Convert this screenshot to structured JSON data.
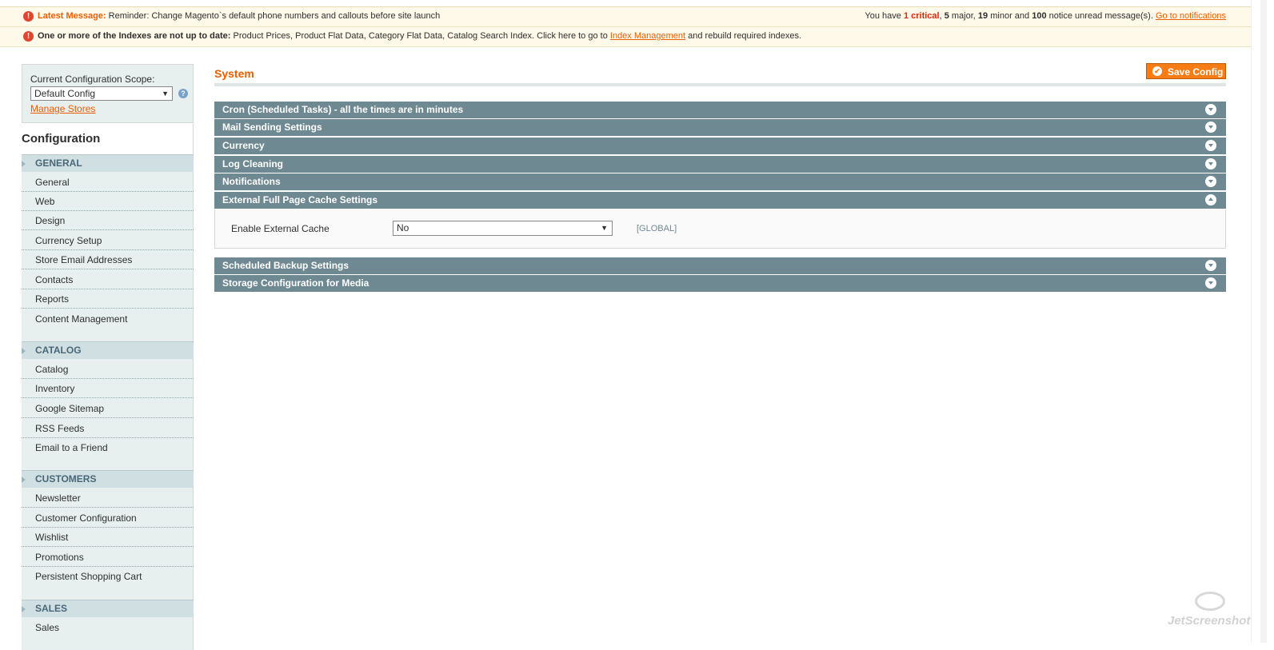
{
  "messages": {
    "latest_label": "Latest Message:",
    "latest_text": "Reminder: Change Magento`s default phone numbers and callouts before site launch",
    "summary_prefix": "You have",
    "critical_count": "1 critical",
    "major_count": "5",
    "major_label": "major,",
    "minor_count": "19",
    "minor_label": "minor and",
    "notice_count": "100",
    "notice_label": "notice unread message(s).",
    "notifications_link": "Go to notifications",
    "index_label": "One or more of the Indexes are not up to date:",
    "index_text": "Product Prices, Product Flat Data, Category Flat Data, Catalog Search Index. Click here to go to",
    "index_link": "Index Management",
    "index_suffix": "and rebuild required indexes."
  },
  "scope": {
    "label": "Current Configuration Scope:",
    "selected": "Default Config",
    "manage_stores": "Manage Stores"
  },
  "sidebar": {
    "title": "Configuration",
    "sections": [
      {
        "label": "GENERAL",
        "items": [
          "General",
          "Web",
          "Design",
          "Currency Setup",
          "Store Email Addresses",
          "Contacts",
          "Reports",
          "Content Management"
        ]
      },
      {
        "label": "CATALOG",
        "items": [
          "Catalog",
          "Inventory",
          "Google Sitemap",
          "RSS Feeds",
          "Email to a Friend"
        ]
      },
      {
        "label": "CUSTOMERS",
        "items": [
          "Newsletter",
          "Customer Configuration",
          "Wishlist",
          "Promotions",
          "Persistent Shopping Cart"
        ]
      },
      {
        "label": "SALES",
        "items": [
          "Sales"
        ]
      }
    ]
  },
  "main": {
    "title": "System",
    "save_label": "Save Config",
    "fieldsets": [
      "Cron (Scheduled Tasks) - all the times are in minutes",
      "Mail Sending Settings",
      "Currency",
      "Log Cleaning",
      "Notifications",
      "External Full Page Cache Settings",
      "Scheduled Backup Settings",
      "Storage Configuration for Media"
    ],
    "open_fieldset": {
      "field_label": "Enable External Cache",
      "field_value": "No",
      "scope_tag": "[GLOBAL]"
    }
  },
  "watermark": "JetScreenshot",
  "colors": {
    "accent": "#eb5e00",
    "fieldset_header": "#6f8992",
    "sidebar_bg": "#e7efef",
    "section_bg": "#d0dfe2",
    "message_bg": "#fff9e9"
  }
}
